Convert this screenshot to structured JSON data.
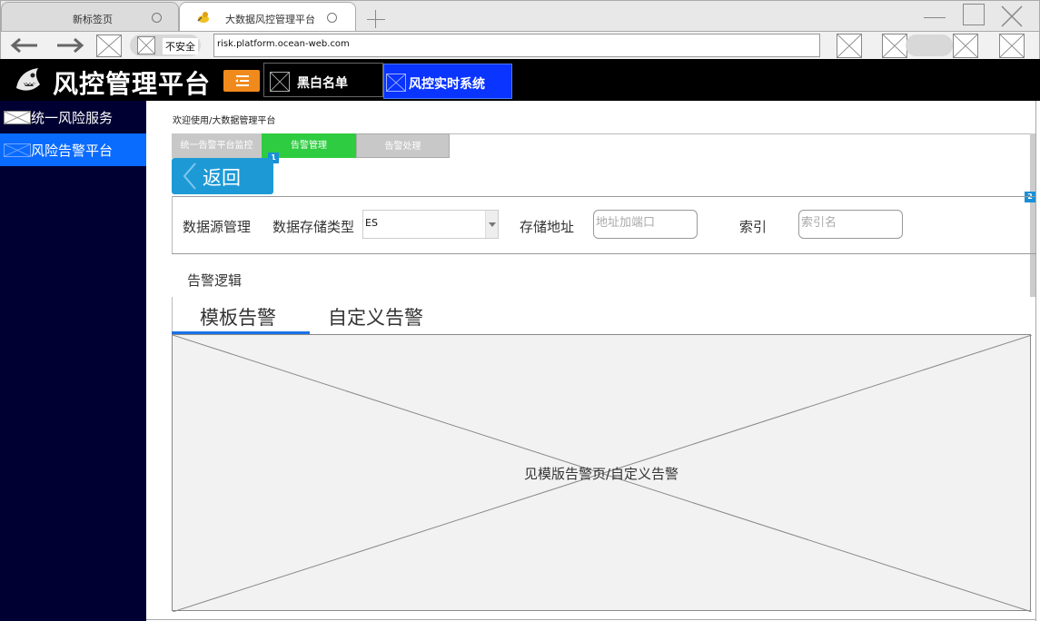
{
  "browser": {
    "tabs": [
      {
        "title": "新标签页"
      },
      {
        "title": "大数据风控管理平台"
      }
    ],
    "security_label": "不安全",
    "url": "risk.platform.ocean-web.com"
  },
  "app": {
    "title": "风控管理平台",
    "nav": [
      {
        "label": "黑白名单"
      },
      {
        "label": "风控实时系统"
      }
    ]
  },
  "sidebar": {
    "items": [
      {
        "label": "统一风险服务"
      },
      {
        "label": "风险告警平台"
      }
    ]
  },
  "main": {
    "breadcrumb": "欢迎使用/大数据管理平台",
    "subtabs": [
      "统一告警平台监控",
      "告警管理",
      "告警处理"
    ],
    "badges": [
      "1",
      "2"
    ],
    "back_label": "返回",
    "datasource": {
      "section_label": "数据源管理",
      "storage_type_label": "数据存储类型",
      "storage_type_value": "ES",
      "address_label": "存储地址",
      "address_placeholder": "地址加端口",
      "index_label": "索引",
      "index_placeholder": "索引名"
    },
    "alert_logic_title": "告警逻辑",
    "alert_tabs": [
      "模板告警",
      "自定义告警"
    ],
    "placeholder_text": "见模版告警页/自定义告警"
  },
  "colors": {
    "header_bg": "#000000",
    "sidebar_bg": "#000033",
    "sidebar_active": "#0a6bff",
    "nav_active": "#0a34ff",
    "menu_toggle": "#f08a1c",
    "subtab_active": "#2ecc40",
    "back_button": "#1d9ad6",
    "tab_underline": "#1a72e8"
  }
}
